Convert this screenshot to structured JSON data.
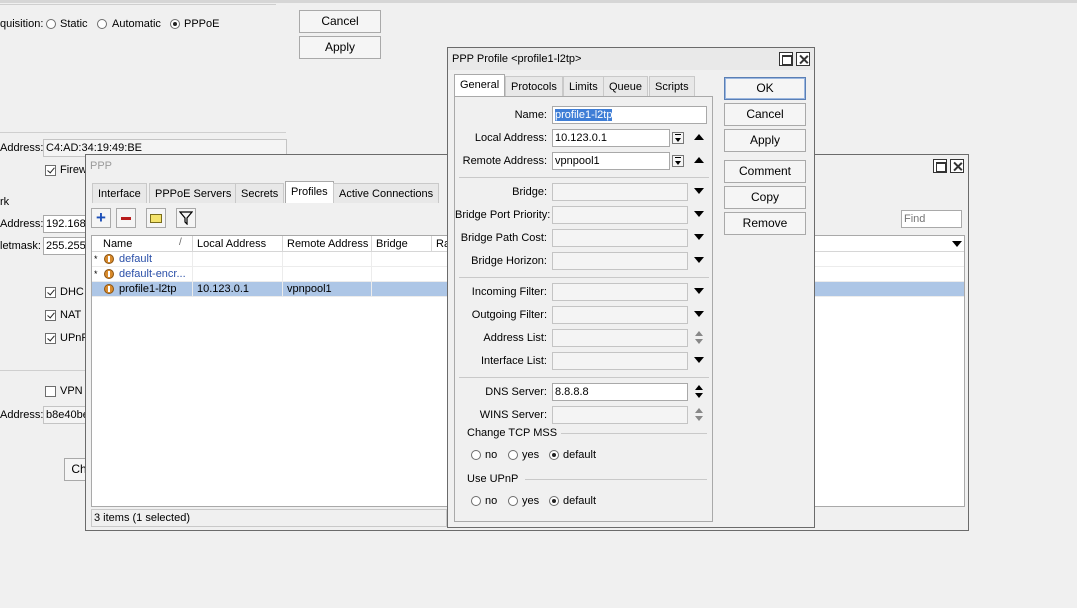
{
  "background": {
    "acquisition_label": "quisition:",
    "acq_options": [
      "Static",
      "Automatic",
      "PPPoE"
    ],
    "cancel": "Cancel",
    "apply": "Apply",
    "mac_label": "Address:",
    "mac_value": "C4:AD:34:19:49:BE",
    "firewall_label": "Firew",
    "network_label": "rk",
    "ip_label": "Address:",
    "ip_value": "192.168",
    "netmask_label": "letmask:",
    "netmask_value": "255.255",
    "dhcp": "DHC",
    "nat": "NAT",
    "upnp": "UPnF",
    "vpn": "VPN",
    "vpn_addr_label": "Address:",
    "vpn_addr_value": "b8e40be",
    "ch_button": "Ch"
  },
  "ppp_window": {
    "title": "PPP",
    "tabs": [
      "Interface",
      "PPPoE Servers",
      "Secrets",
      "Profiles",
      "Active Connections"
    ],
    "find_placeholder": "Find",
    "columns": [
      "Name",
      "Local Address",
      "Remote Address",
      "Bridge",
      "Ra"
    ],
    "rows": [
      {
        "flag": "*",
        "name": "default",
        "local": "",
        "remote": ""
      },
      {
        "flag": "*",
        "name": "default-encr...",
        "local": "",
        "remote": ""
      },
      {
        "flag": "",
        "name": "profile1-l2tp",
        "local": "10.123.0.1",
        "remote": "vpnpool1"
      }
    ],
    "status": "3 items (1 selected)"
  },
  "profile_window": {
    "title": "PPP Profile <profile1-l2tp>",
    "tabs": [
      "General",
      "Protocols",
      "Limits",
      "Queue",
      "Scripts"
    ],
    "fields": {
      "name_label": "Name:",
      "name_value": "profile1-l2tp",
      "local_label": "Local Address:",
      "local_value": "10.123.0.1",
      "remote_label": "Remote Address:",
      "remote_value": "vpnpool1",
      "bridge_label": "Bridge:",
      "bridge_port_priority_label": "Bridge Port Priority:",
      "bridge_path_cost_label": "Bridge Path Cost:",
      "bridge_horizon_label": "Bridge Horizon:",
      "incoming_filter_label": "Incoming Filter:",
      "outgoing_filter_label": "Outgoing Filter:",
      "address_list_label": "Address List:",
      "interface_list_label": "Interface List:",
      "dns_label": "DNS Server:",
      "dns_value": "8.8.8.8",
      "wins_label": "WINS Server:"
    },
    "tcp_mss": {
      "legend": "Change TCP MSS",
      "options": [
        "no",
        "yes",
        "default"
      ]
    },
    "upnp": {
      "legend": "Use UPnP",
      "options": [
        "no",
        "yes",
        "default"
      ]
    },
    "buttons": [
      "OK",
      "Cancel",
      "Apply",
      "Comment",
      "Copy",
      "Remove"
    ]
  }
}
